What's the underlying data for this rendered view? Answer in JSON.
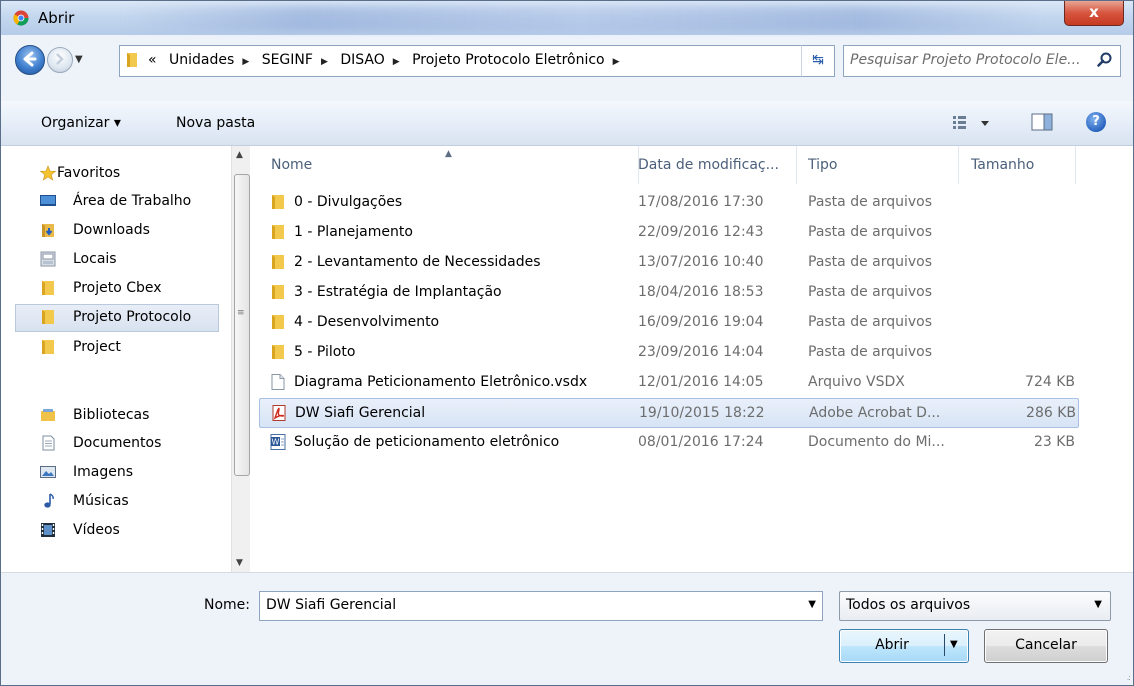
{
  "window": {
    "title": "Abrir",
    "close_label": "x"
  },
  "address": {
    "overflow": "«",
    "path": [
      "Unidades",
      "SEGINF",
      "DISAO",
      "Projeto Protocolo Eletrônico"
    ],
    "search_placeholder": "Pesquisar Projeto Protocolo Ele..."
  },
  "toolbar": {
    "organize": "Organizar ▾",
    "new_folder": "Nova pasta",
    "help": "?"
  },
  "nav": {
    "favorites": "Favoritos",
    "fav_items": [
      "Área de Trabalho",
      "Downloads",
      "Locais",
      "Projeto Cbex",
      "Projeto Protocolo",
      "Project"
    ],
    "libraries": "Bibliotecas",
    "lib_items": [
      "Documentos",
      "Imagens",
      "Músicas",
      "Vídeos"
    ]
  },
  "columns": {
    "name": "Nome",
    "date": "Data de modificaç...",
    "type": "Tipo",
    "size": "Tamanho"
  },
  "files": [
    {
      "name": "0 - Divulgações",
      "date": "17/08/2016 17:30",
      "type": "Pasta de arquivos",
      "size": "",
      "icon": "folder-icon"
    },
    {
      "name": "1 - Planejamento",
      "date": "22/09/2016 12:43",
      "type": "Pasta de arquivos",
      "size": "",
      "icon": "folder-icon"
    },
    {
      "name": "2 - Levantamento de Necessidades",
      "date": "13/07/2016 10:40",
      "type": "Pasta de arquivos",
      "size": "",
      "icon": "folder-icon"
    },
    {
      "name": "3 - Estratégia de Implantação",
      "date": "18/04/2016 18:53",
      "type": "Pasta de arquivos",
      "size": "",
      "icon": "folder-icon"
    },
    {
      "name": "4 - Desenvolvimento",
      "date": "16/09/2016 19:04",
      "type": "Pasta de arquivos",
      "size": "",
      "icon": "folder-icon"
    },
    {
      "name": "5 - Piloto",
      "date": "23/09/2016 14:04",
      "type": "Pasta de arquivos",
      "size": "",
      "icon": "folder-icon"
    },
    {
      "name": "Diagrama Peticionamento Eletrônico.vsdx",
      "date": "12/01/2016 14:05",
      "type": "Arquivo VSDX",
      "size": "724 KB",
      "icon": "document-icon"
    },
    {
      "name": "DW Siafi Gerencial",
      "date": "19/10/2015 18:22",
      "type": "Adobe Acrobat D...",
      "size": "286 KB",
      "icon": "pdf-icon"
    },
    {
      "name": "Solução de peticionamento eletrônico",
      "date": "08/01/2016 17:24",
      "type": "Documento do Mi...",
      "size": "23 KB",
      "icon": "word-doc-icon"
    }
  ],
  "bottom": {
    "filename_label": "Nome:",
    "filename_value": "DW Siafi Gerencial",
    "filter_value": "Todos os arquivos",
    "open_label": "Abrir",
    "cancel_label": "Cancelar"
  },
  "colors": {
    "selection": "#d7e4f5",
    "selection_border": "#a8c1e2",
    "folder": "#e9b94a",
    "accent": "#2a64c0"
  }
}
